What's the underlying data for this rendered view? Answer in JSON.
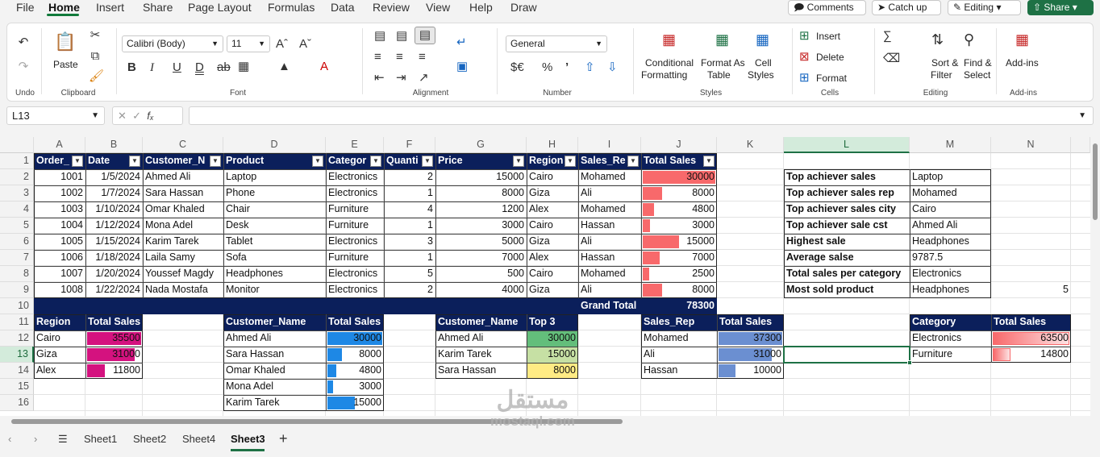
{
  "menu": {
    "tabs": [
      "File",
      "Home",
      "Insert",
      "Share",
      "Page Layout",
      "Formulas",
      "Data",
      "Review",
      "View",
      "Help",
      "Draw"
    ],
    "active": "Home"
  },
  "header_buttons": {
    "comments": "Comments",
    "catchup": "Catch up",
    "editing": "Editing",
    "share": "Share"
  },
  "ribbon": {
    "undo_label": "Undo",
    "paste_label": "Paste",
    "clipboard_label": "Clipboard",
    "font_name": "Calibri (Body)",
    "font_size": "11",
    "font_label": "Font",
    "alignment_label": "Alignment",
    "number_format": "General",
    "number_label": "Number",
    "conditional": [
      "Conditional",
      "Formatting"
    ],
    "format_as_table": [
      "Format As",
      "Table"
    ],
    "cell_styles": [
      "Cell",
      "Styles"
    ],
    "styles_label": "Styles",
    "insert": "Insert",
    "delete": "Delete",
    "format": "Format",
    "cells_label": "Cells",
    "sort_filter": [
      "Sort &",
      "Filter"
    ],
    "find_select": [
      "Find &",
      "Select"
    ],
    "editing_label": "Editing",
    "addins": "Add-ins",
    "addins_label": "Add-ins"
  },
  "name_box": "L13",
  "columns": [
    "A",
    "B",
    "C",
    "D",
    "E",
    "F",
    "G",
    "H",
    "I",
    "J",
    "K",
    "L",
    "M",
    "N"
  ],
  "rows": [
    "1",
    "2",
    "3",
    "4",
    "5",
    "6",
    "7",
    "8",
    "9",
    "10",
    "11",
    "12",
    "13",
    "14",
    "15",
    "16"
  ],
  "selected_cell": "L13",
  "table": {
    "headers": [
      "Order_",
      "Date",
      "Customer_N",
      "Product",
      "Categor",
      "Quanti",
      "Price",
      "Region",
      "Sales_Re",
      "Total Sales"
    ],
    "rows": [
      [
        "1001",
        "1/5/2024",
        "Ahmed Ali",
        "Laptop",
        "Electronics",
        "2",
        "15000",
        "Cairo",
        "Mohamed",
        "30000"
      ],
      [
        "1002",
        "1/7/2024",
        "Sara Hassan",
        "Phone",
        "Electronics",
        "1",
        "8000",
        "Giza",
        "Ali",
        "8000"
      ],
      [
        "1003",
        "1/10/2024",
        "Omar Khaled",
        "Chair",
        "Furniture",
        "4",
        "1200",
        "Alex",
        "Mohamed",
        "4800"
      ],
      [
        "1004",
        "1/12/2024",
        "Mona Adel",
        "Desk",
        "Furniture",
        "1",
        "3000",
        "Cairo",
        "Hassan",
        "3000"
      ],
      [
        "1005",
        "1/15/2024",
        "Karim Tarek",
        "Tablet",
        "Electronics",
        "3",
        "5000",
        "Giza",
        "Ali",
        "15000"
      ],
      [
        "1006",
        "1/18/2024",
        "Laila Samy",
        "Sofa",
        "Furniture",
        "1",
        "7000",
        "Alex",
        "Hassan",
        "7000"
      ],
      [
        "1007",
        "1/20/2024",
        "Youssef Magdy",
        "Headphones",
        "Electronics",
        "5",
        "500",
        "Cairo",
        "Mohamed",
        "2500"
      ],
      [
        "1008",
        "1/22/2024",
        "Nada Mostafa",
        "Monitor",
        "Electronics",
        "2",
        "4000",
        "Giza",
        "Ali",
        "8000"
      ]
    ],
    "grand_total_label": "Grand Total",
    "grand_total": "78300"
  },
  "summary": [
    [
      "Top achiever sales",
      "Laptop"
    ],
    [
      "Top achiever sales rep",
      "Mohamed"
    ],
    [
      "Top achiever sales city",
      "Cairo"
    ],
    [
      "Top achiever sale cst",
      "Ahmed Ali"
    ],
    [
      "Highest sale",
      "Headphones"
    ],
    [
      "Average salse",
      "9787.5"
    ],
    [
      "Total sales per category",
      "Electronics"
    ],
    [
      "Most sold product",
      "Headphones"
    ]
  ],
  "n9_value": "5",
  "region_table": {
    "headers": [
      "Region",
      "Total Sales"
    ],
    "rows": [
      [
        "Cairo",
        "35500"
      ],
      [
        "Giza",
        "31000"
      ],
      [
        "Alex",
        "11800"
      ]
    ]
  },
  "customer_table": {
    "headers": [
      "Customer_Name",
      "Total Sales"
    ],
    "rows": [
      [
        "Ahmed Ali",
        "30000"
      ],
      [
        "Sara Hassan",
        "8000"
      ],
      [
        "Omar Khaled",
        "4800"
      ],
      [
        "Mona Adel",
        "3000"
      ],
      [
        "Karim Tarek",
        "15000"
      ]
    ]
  },
  "top3_table": {
    "headers": [
      "Customer_Name",
      "Top 3"
    ],
    "rows": [
      [
        "Ahmed Ali",
        "30000"
      ],
      [
        "Karim Tarek",
        "15000"
      ],
      [
        "Sara Hassan",
        "8000"
      ]
    ]
  },
  "rep_table": {
    "headers": [
      "Sales_Rep",
      "Total Sales"
    ],
    "rows": [
      [
        "Mohamed",
        "37300"
      ],
      [
        "Ali",
        "31000"
      ],
      [
        "Hassan",
        "10000"
      ]
    ]
  },
  "category_table": {
    "headers": [
      "Category",
      "Total Sales"
    ],
    "rows": [
      [
        "Electronics",
        "63500"
      ],
      [
        "Furniture",
        "14800"
      ]
    ]
  },
  "sheets": [
    "Sheet1",
    "Sheet2",
    "Sheet4",
    "Sheet3"
  ],
  "active_sheet": "Sheet3",
  "watermark": {
    "arabic": "مستقل",
    "latin": "mostaql.com"
  },
  "colors": {
    "header_navy": "#0b1f5b",
    "bar_red": "#f8696b",
    "bar_magenta": "#d4127f",
    "bar_blue": "#1e88e5",
    "bar_steel": "#6b8fd1",
    "green": "#63be7b",
    "light_green": "#c6e0a4",
    "yellow": "#ffeb84",
    "accent": "#1e7145"
  }
}
